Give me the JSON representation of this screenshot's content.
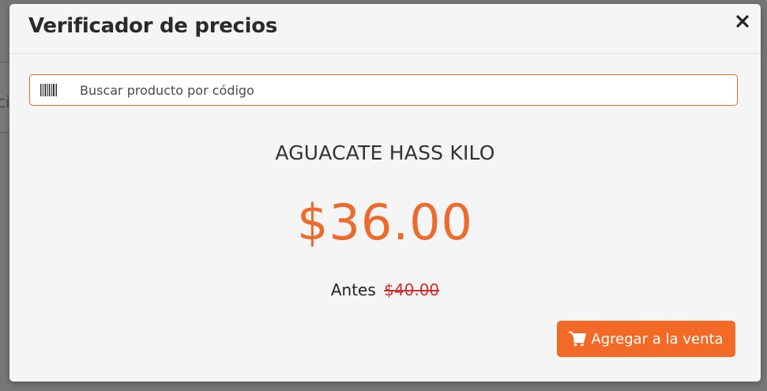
{
  "modal": {
    "title": "Verificador de precios",
    "close_icon": "close-icon"
  },
  "search": {
    "icon": "barcode-icon",
    "placeholder": "Buscar producto por código",
    "value": ""
  },
  "product": {
    "name": "AGUACATE HASS KILO",
    "price": "$36.00",
    "before_label": "Antes",
    "before_price": "$40.00"
  },
  "actions": {
    "add_label": "Agregar a la venta",
    "add_icon": "shopping-cart-icon"
  },
  "colors": {
    "accent": "#f26a25",
    "price": "#ee6a2b",
    "old_price": "#c9302c"
  }
}
